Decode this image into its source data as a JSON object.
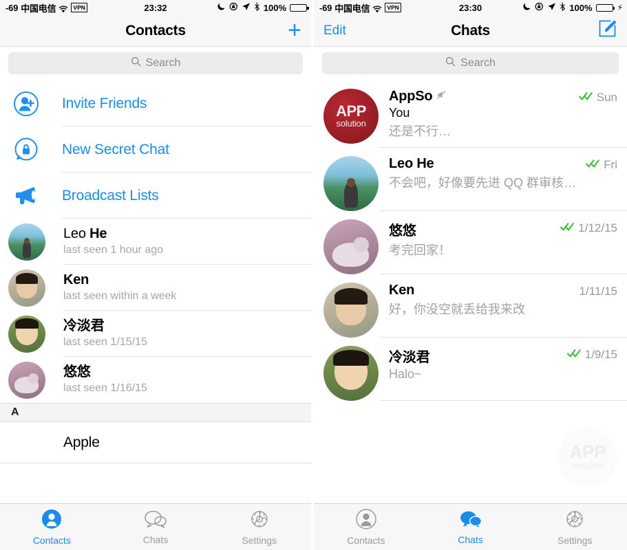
{
  "left_screen": {
    "status_bar": {
      "signal": "-69",
      "carrier": "中国电信",
      "wifi_icon": "wifi-icon",
      "vpn_label": "VPN",
      "time": "23:32",
      "moon_icon": "moon-icon",
      "rotation_lock_icon": "rotation-lock-icon",
      "location_icon": "location-arrow-icon",
      "bluetooth_icon": "bluetooth-icon",
      "battery_percent": "100%",
      "battery_state": "full",
      "battery_color": "#000000"
    },
    "nav": {
      "title": "Contacts",
      "right_action": "+",
      "right_action_icon": "plus-icon",
      "accent_color": "#1f8ff0"
    },
    "search": {
      "placeholder": "Search",
      "icon": "search-icon"
    },
    "actions": [
      {
        "label": "Invite Friends",
        "icon": "add-person-icon"
      },
      {
        "label": "New Secret Chat",
        "icon": "lock-bubble-icon"
      },
      {
        "label": "Broadcast Lists",
        "icon": "megaphone-icon"
      }
    ],
    "contacts": [
      {
        "first": "Leo",
        "last": "He",
        "status": "last seen 1 hour ago",
        "avatar": "av-leo"
      },
      {
        "first": "Ken",
        "last": "",
        "status": "last seen within a week",
        "avatar": "av-ken"
      },
      {
        "first": "冷淡君",
        "last": "",
        "status": "last seen 1/15/15",
        "avatar": "av-leng"
      },
      {
        "first": "悠悠",
        "last": "",
        "status": "last seen 1/16/15",
        "avatar": "av-cat"
      }
    ],
    "section_header": "A",
    "section_rows": [
      {
        "name": "Apple"
      }
    ],
    "tabs": [
      {
        "label": "Contacts",
        "icon": "person-icon",
        "active": true
      },
      {
        "label": "Chats",
        "icon": "chat-bubbles-icon",
        "active": false
      },
      {
        "label": "Settings",
        "icon": "gear-icon",
        "active": false
      }
    ]
  },
  "right_screen": {
    "status_bar": {
      "signal": "-69",
      "carrier": "中国电信",
      "wifi_icon": "wifi-icon",
      "vpn_label": "VPN",
      "time": "23:30",
      "moon_icon": "moon-icon",
      "rotation_lock_icon": "rotation-lock-icon",
      "location_icon": "location-arrow-icon",
      "bluetooth_icon": "bluetooth-icon",
      "battery_percent": "100%",
      "battery_state": "charging",
      "battery_color": "#4cd661",
      "charging_bolt": "⚡"
    },
    "nav": {
      "left_action": "Edit",
      "title": "Chats",
      "right_action_icon": "compose-icon",
      "accent_color": "#1b8ceb"
    },
    "search": {
      "placeholder": "Search",
      "icon": "search-icon"
    },
    "chats": [
      {
        "name": "AppSo",
        "muted": true,
        "mute_icon": "mute-speaker-icon",
        "sender": "You",
        "preview": "还是不行…",
        "ticks": "✓✓",
        "read": true,
        "date": "Sun",
        "avatar": "av-appso"
      },
      {
        "name": "Leo He",
        "muted": false,
        "sender": "",
        "preview": "不会吧，好像要先进 QQ 群审核…",
        "ticks": "✓✓",
        "read": true,
        "date": "Fri",
        "avatar": "av-leo"
      },
      {
        "name": "悠悠",
        "muted": false,
        "sender": "",
        "preview": "考完回家！",
        "ticks": "✓✓",
        "read": true,
        "date": "1/12/15",
        "avatar": "av-cat"
      },
      {
        "name": "Ken",
        "muted": false,
        "sender": "",
        "preview": "好，你没空就丢给我来改",
        "ticks": "",
        "read": false,
        "date": "1/11/15",
        "avatar": "av-ken"
      },
      {
        "name": "冷淡君",
        "muted": false,
        "sender": "",
        "preview": "Halo~",
        "ticks": "✓✓",
        "read": true,
        "date": "1/9/15",
        "avatar": "av-leng"
      }
    ],
    "watermark": {
      "line1": "APP",
      "line2": "solution"
    },
    "tabs": [
      {
        "label": "Contacts",
        "icon": "person-icon",
        "active": false
      },
      {
        "label": "Chats",
        "icon": "chat-bubbles-icon",
        "active": true
      },
      {
        "label": "Settings",
        "icon": "gear-icon",
        "active": false
      }
    ]
  }
}
